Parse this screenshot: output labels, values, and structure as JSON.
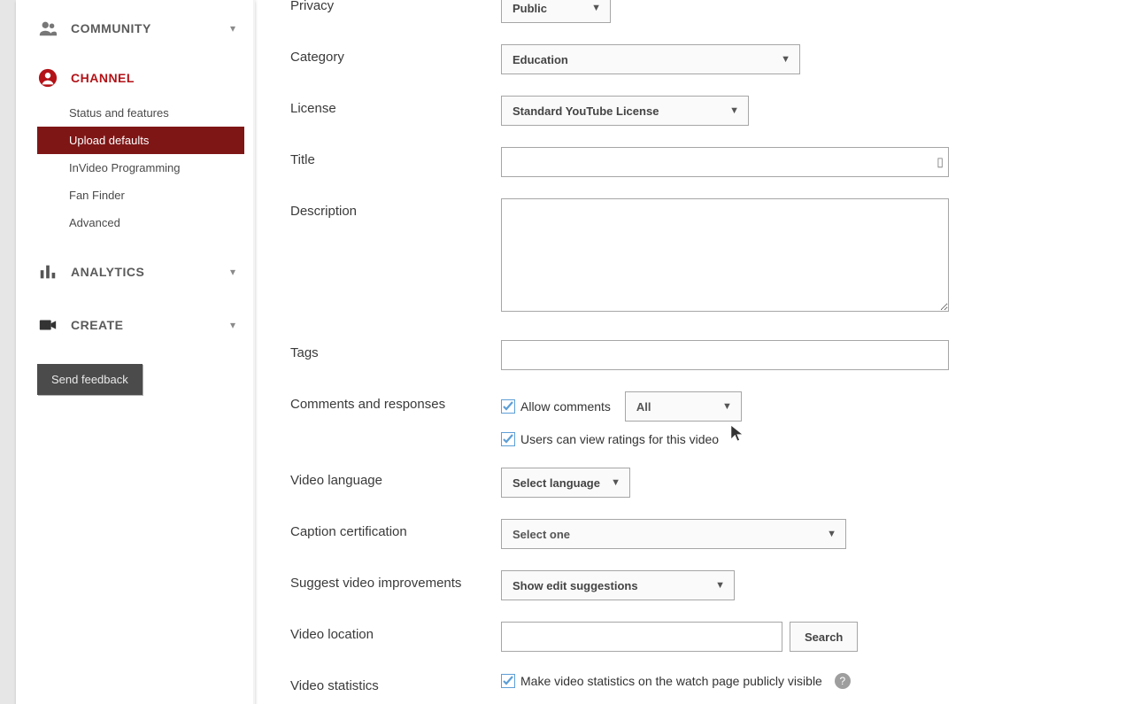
{
  "sidebar": {
    "community": "COMMUNITY",
    "channel": "CHANNEL",
    "channel_items": [
      "Status and features",
      "Upload defaults",
      "InVideo Programming",
      "Fan Finder",
      "Advanced"
    ],
    "analytics": "ANALYTICS",
    "create": "CREATE",
    "feedback": "Send feedback"
  },
  "form": {
    "privacy_label": "Privacy",
    "privacy_value": "Public",
    "category_label": "Category",
    "category_value": "Education",
    "license_label": "License",
    "license_value": "Standard YouTube License",
    "title_label": "Title",
    "description_label": "Description",
    "tags_label": "Tags",
    "comments_label": "Comments and responses",
    "allow_comments": "Allow comments",
    "comments_filter": "All",
    "ratings_view": "Users can view ratings for this video",
    "video_language_label": "Video language",
    "video_language_value": "Select language",
    "caption_label": "Caption certification",
    "caption_value": "Select one",
    "suggest_label": "Suggest video improvements",
    "suggest_value": "Show edit suggestions",
    "location_label": "Video location",
    "search_btn": "Search",
    "stats_label": "Video statistics",
    "stats_cb": "Make video statistics on the watch page publicly visible"
  }
}
